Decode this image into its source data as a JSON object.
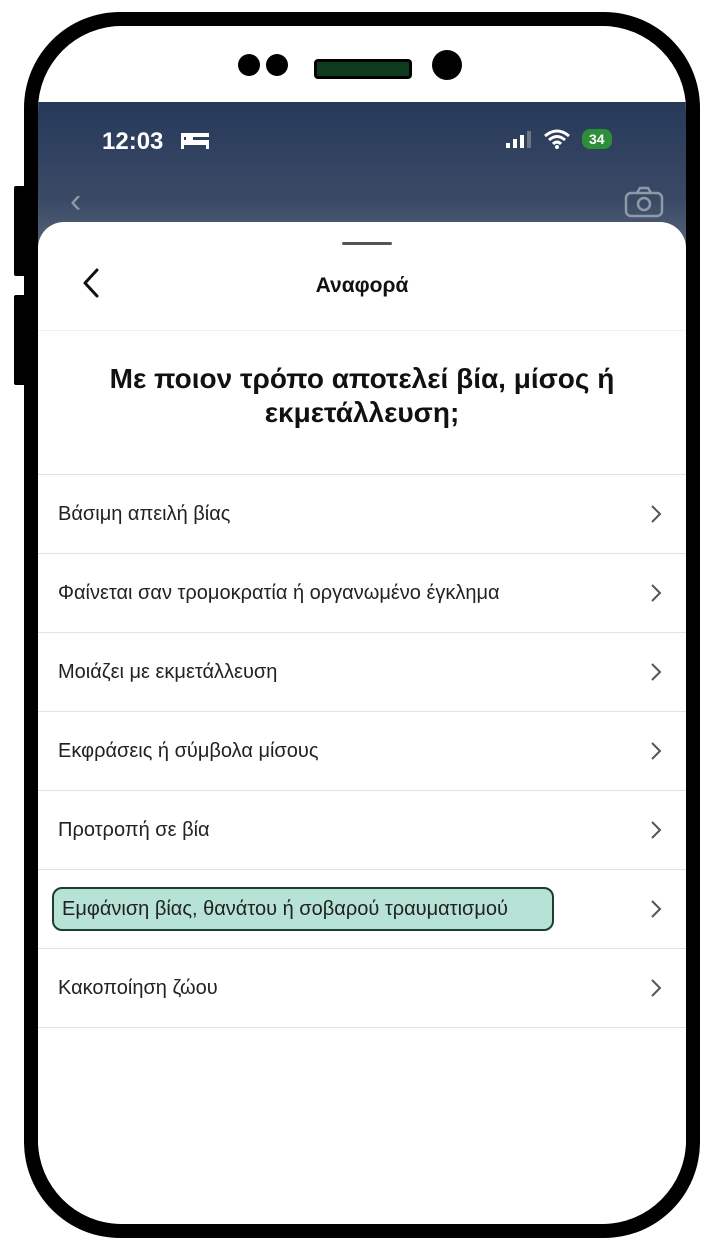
{
  "status_bar": {
    "time": "12:03",
    "battery": "34",
    "icons": [
      "bed-icon",
      "signal-icon",
      "wifi-icon",
      "battery-icon"
    ]
  },
  "sheet": {
    "title": "Αναφορά",
    "question": "Με ποιον τρόπο αποτελεί βία, μίσος ή εκμετάλλευση;"
  },
  "options": [
    {
      "label": "Βάσιμη απειλή βίας"
    },
    {
      "label": "Φαίνεται σαν τρομοκρατία ή οργανωμένο έγκλημα"
    },
    {
      "label": "Μοιάζει με εκμετάλλευση"
    },
    {
      "label": "Εκφράσεις ή σύμβολα μίσους"
    },
    {
      "label": "Προτροπή σε βία"
    },
    {
      "label": "Εμφάνιση βίας, θανάτου ή σοβαρού τραυματισμού",
      "highlighted": true
    },
    {
      "label": "Κακοποίηση ζώου"
    }
  ],
  "colors": {
    "highlight": "#b6e3d5",
    "battery": "#2e8f3a"
  }
}
